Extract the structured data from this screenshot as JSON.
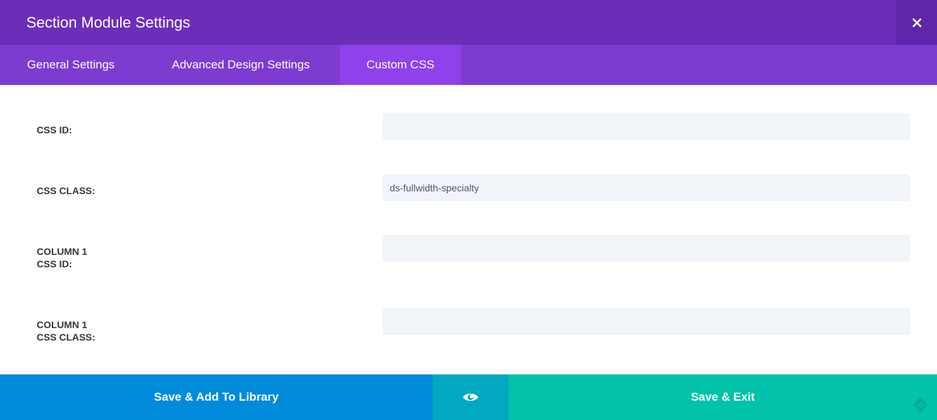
{
  "modal": {
    "title": "Section Module Settings",
    "close_icon": "close-icon"
  },
  "tabs": [
    {
      "label": "General Settings",
      "active": false
    },
    {
      "label": "Advanced Design Settings",
      "active": false
    },
    {
      "label": "Custom CSS",
      "active": true
    }
  ],
  "fields": [
    {
      "label_line1": "CSS ID:",
      "label_line2": "",
      "value": "",
      "placeholder": ""
    },
    {
      "label_line1": "CSS CLASS:",
      "label_line2": "",
      "value": "ds-fullwidth-specialty",
      "placeholder": ""
    },
    {
      "label_line1": "COLUMN 1",
      "label_line2": "CSS ID:",
      "value": "",
      "placeholder": ""
    },
    {
      "label_line1": "COLUMN 1",
      "label_line2": "CSS CLASS:",
      "value": "",
      "placeholder": ""
    }
  ],
  "footer": {
    "save_library_label": "Save & Add To Library",
    "preview_icon": "eye-icon",
    "save_exit_label": "Save & Exit",
    "resize_icon": "resize-handle-icon"
  },
  "colors": {
    "header": "#6c2eb9",
    "tabs_bar": "#7e3bd0",
    "tab_active": "#8f42ec",
    "library_button": "#008bdb",
    "preview_button": "#00a8c0",
    "exit_button": "#00c3aa",
    "input_bg": "#f1f5f9"
  }
}
